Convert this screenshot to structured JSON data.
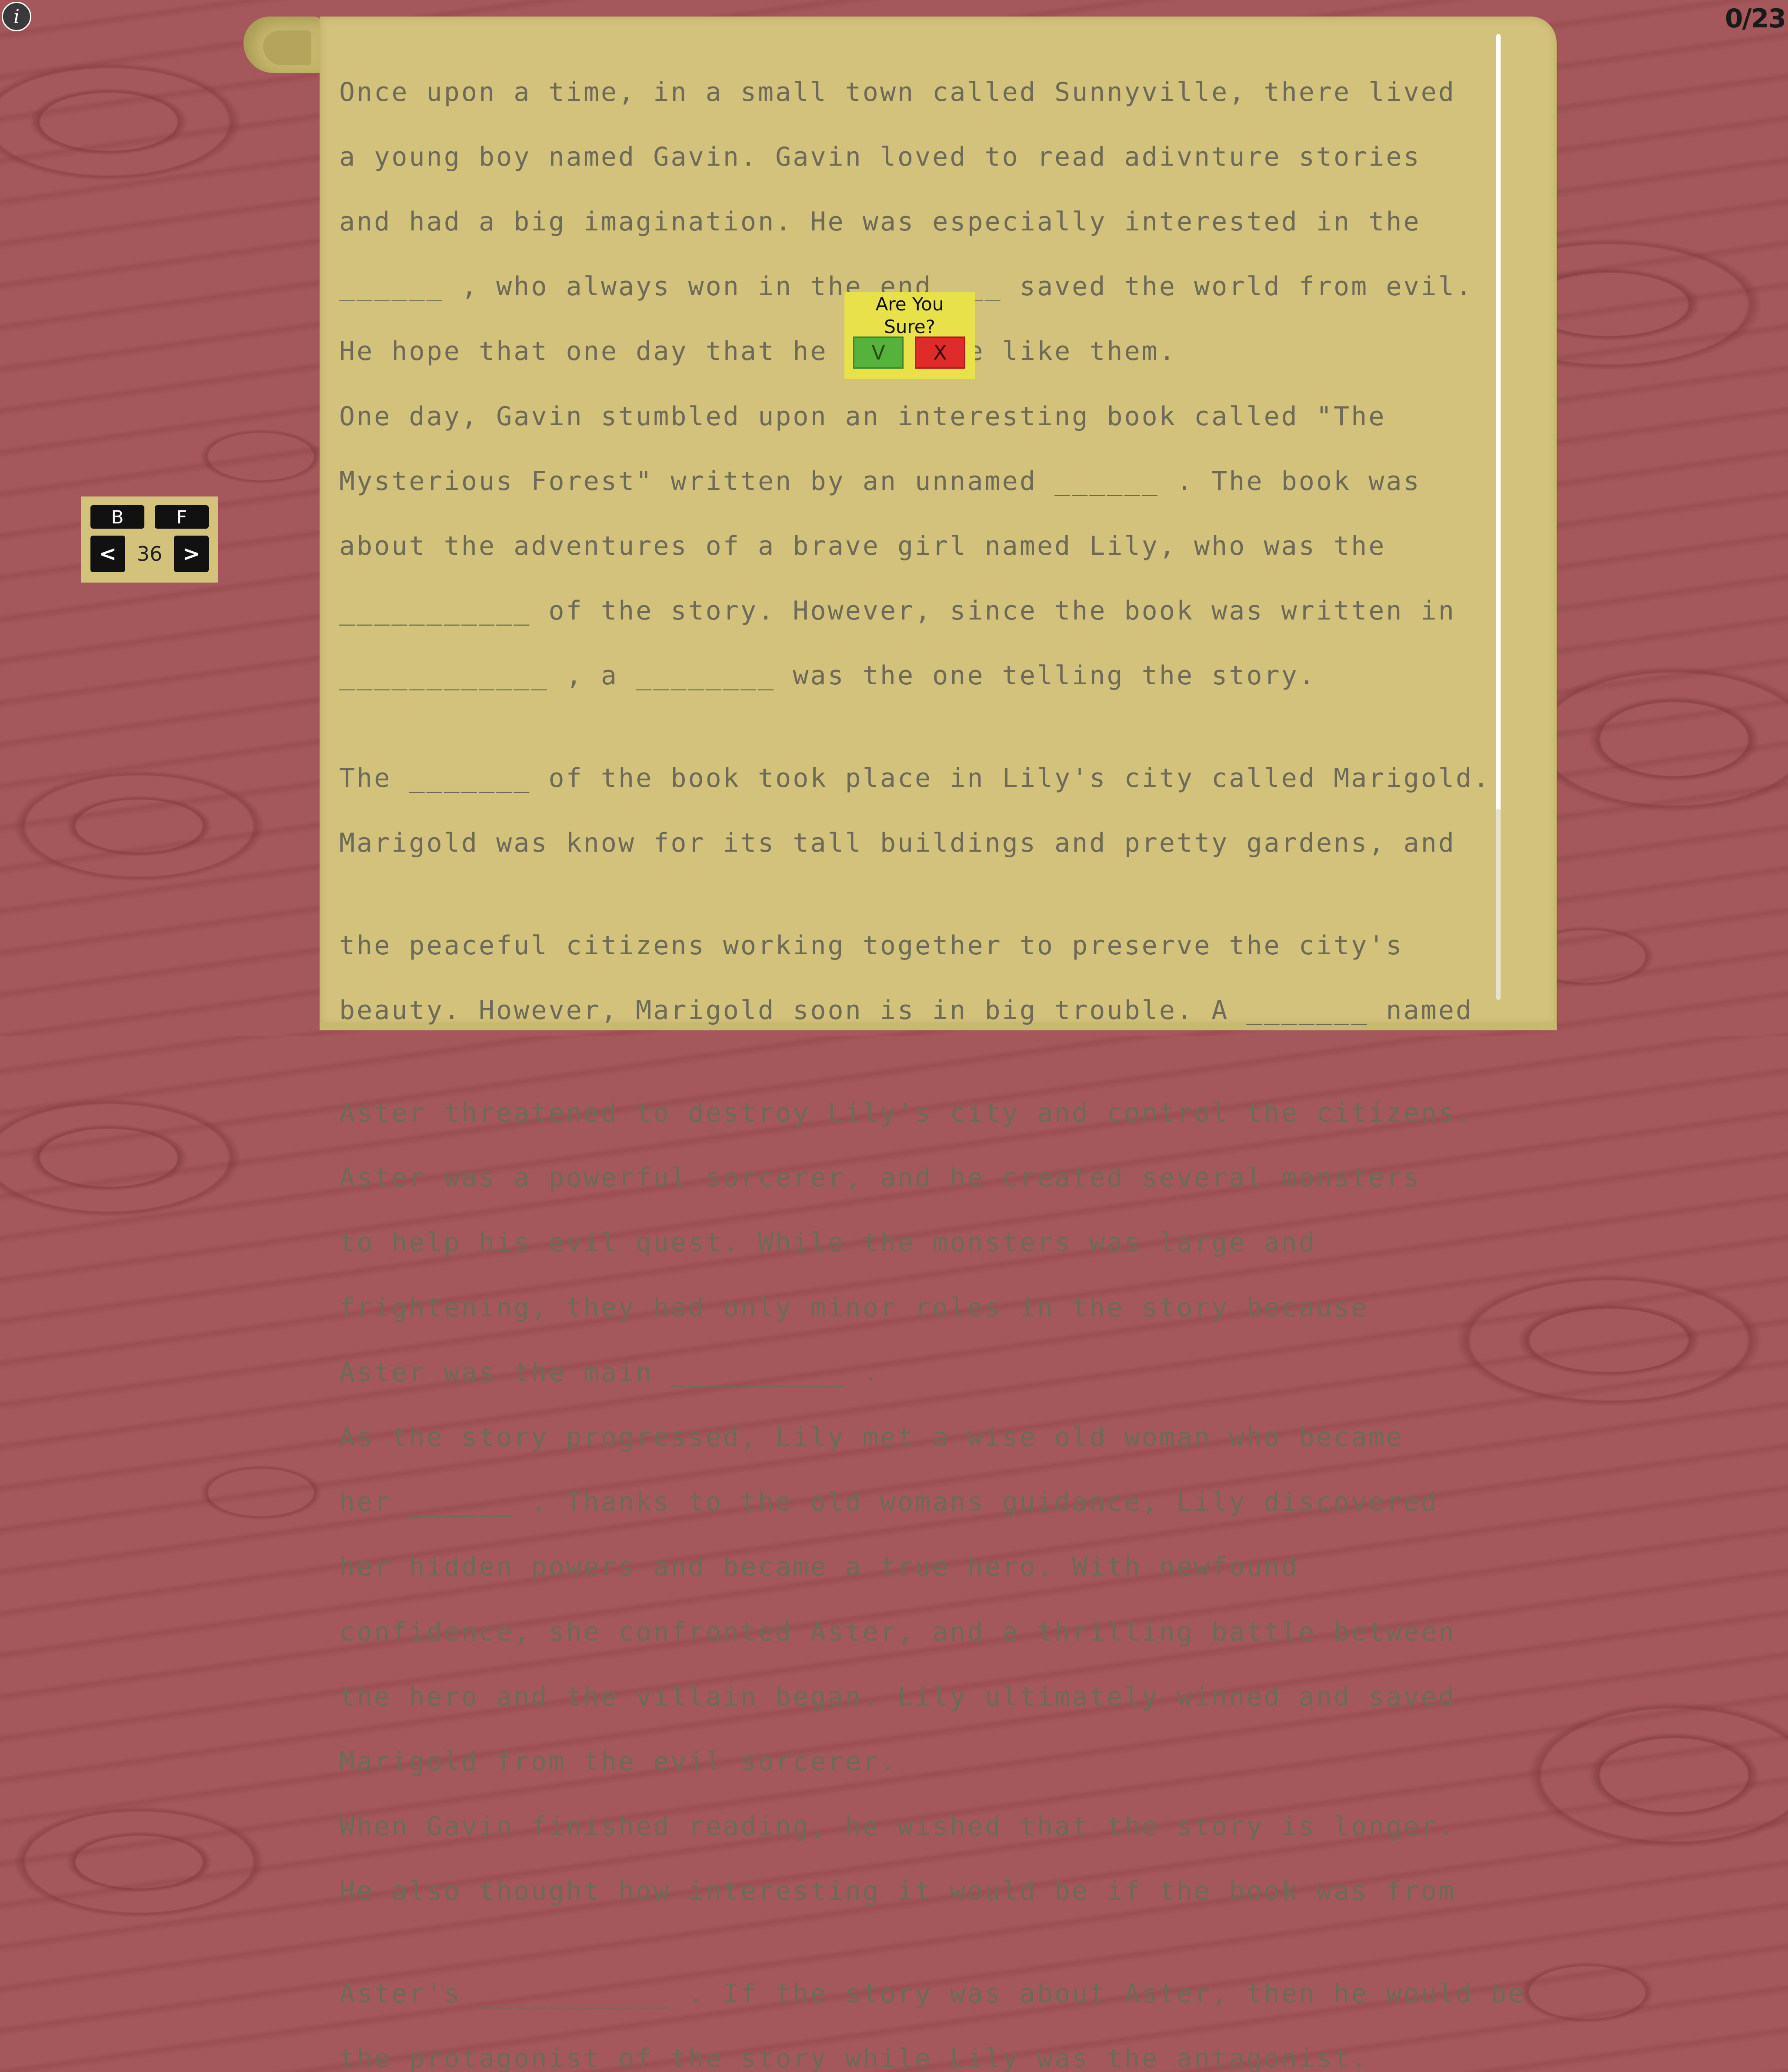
{
  "hud": {
    "info_label": "i",
    "score": "0/23"
  },
  "controls": {
    "back_label": "B",
    "forward_label": "F",
    "prev_label": "<",
    "next_label": ">",
    "page_number": "36"
  },
  "confirm_dialog": {
    "title_line1": "Are You",
    "title_line2": "Sure?",
    "confirm_label": "V",
    "cancel_label": "X"
  },
  "story": {
    "lines": [
      "Once upon a time, in a small town called Sunnyville, there lived",
      "a young boy named Gavin. Gavin loved to read adivnture stories",
      "and had a big imagination. He was especially interested in the",
      "______ , who always won in the end ___ saved the world from evil.",
      "He hope that one day that he could be like them.",
      "One day, Gavin stumbled upon an interesting book called \"The",
      "Mysterious Forest\" written by an unnamed ______ . The book was",
      "about the adventures of a brave girl named Lily, who was the",
      "___________ of the story. However, since the book was written in",
      "____________ , a ________ was the one telling the story.",
      "The _______ of the book took place in Lily's city called Marigold.",
      "Marigold was know for its tall buildings and pretty gardens, and",
      "the peaceful citizens working together to preserve the city's",
      "beauty. However, Marigold soon is in big trouble. A _______ named",
      "Aster threatened to destroy Lily's city and control the citizens.",
      "Aster was a powerful sorcerer, and he created several monsters",
      "to help his evil quest. While the monsters was large and",
      "frightening, they had only minor roles in the story because",
      "Aster was the main __________ .",
      "As the story progressed, Lily met a wise old woman who became",
      "her ______ . Thanks to the old womans guidance, Lily discovered",
      "her hidden powers and became a true hero. With newfound",
      "confidence, she confronted Aster, and a thrilling battle between",
      "the hero and the villain began. Lily ultimately winned and saved",
      "Marigold from the evil sorcerer.",
      "When Gavin finished reading, he wished that the story is longer.",
      "He also thought how interesting it would be if the book was from",
      "Aster's ___________ . If the story was about Aster, then he would be",
      "the protagonist of the story while Lily was the antagonist."
    ]
  },
  "colors": {
    "background": "#a4585b",
    "parchment": "#d2c27b",
    "text": "#6d6a57",
    "dialog": "#e8e14a",
    "confirm": "#55b33c",
    "cancel": "#e02b2b"
  }
}
